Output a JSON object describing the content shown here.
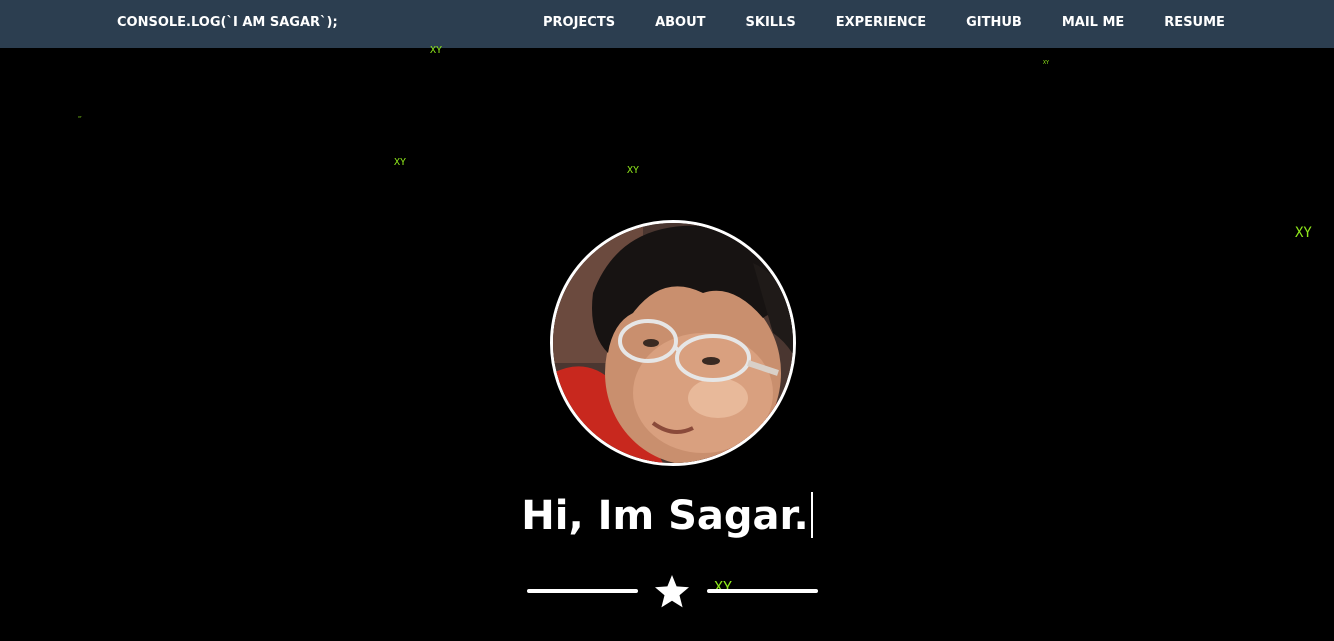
{
  "navbar": {
    "brand": "CONSOLE.LOG(`I AM SAGAR`);",
    "links": [
      "PROJECTS",
      "ABOUT",
      "SKILLS",
      "EXPERIENCE",
      "GITHUB",
      "MAIL ME",
      "RESUME"
    ]
  },
  "hero": {
    "avatar_icon": "profile-photo",
    "greeting": "Hi, Im Sagar.",
    "divider_icon": "star-icon"
  },
  "matrix_glyphs": [
    "XY",
    "XY",
    "XY",
    "XY",
    "XY",
    "XY",
    "XY",
    "XY"
  ],
  "colors": {
    "navbar_bg": "#2c3e50",
    "page_bg": "#000000",
    "text": "#ffffff",
    "matrix_green": "#8fe81b"
  }
}
